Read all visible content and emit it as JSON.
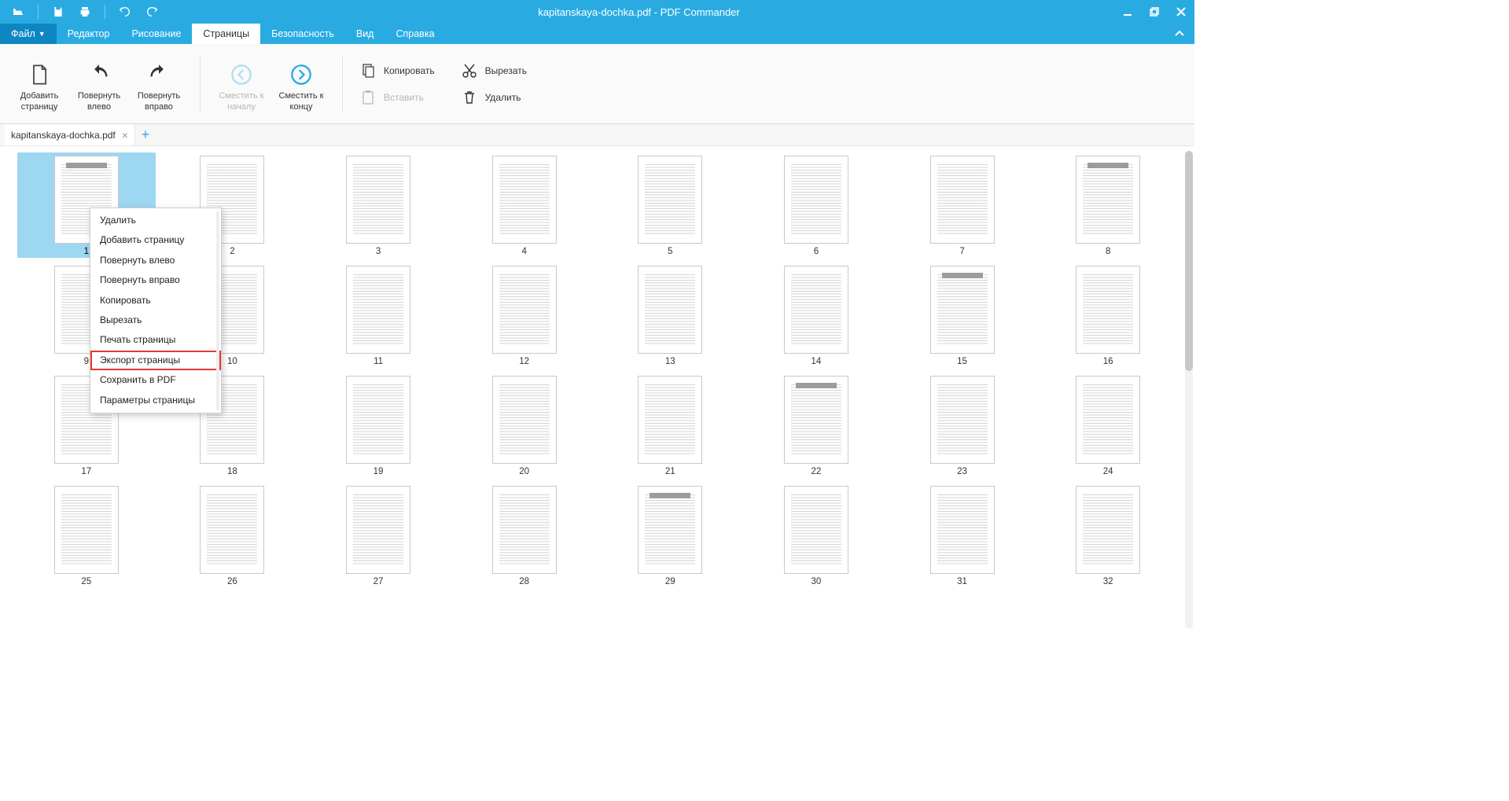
{
  "window": {
    "title": "kapitanskaya-dochka.pdf - PDF Commander"
  },
  "menubar": {
    "file": "Файл",
    "items": [
      "Редактор",
      "Рисование",
      "Страницы",
      "Безопасность",
      "Вид",
      "Справка"
    ],
    "active_index": 2
  },
  "ribbon": {
    "add_page": "Добавить\nстраницу",
    "rotate_left": "Повернуть\nвлево",
    "rotate_right": "Повернуть\nвправо",
    "shift_start": "Сместить к\nначалу",
    "shift_end": "Сместить к\nконцу",
    "copy": "Копировать",
    "paste": "Вставить",
    "cut": "Вырезать",
    "delete": "Удалить"
  },
  "doc_tab": {
    "name": "kapitanskaya-dochka.pdf"
  },
  "context_menu": {
    "items": [
      "Удалить",
      "Добавить страницу",
      "Повернуть влево",
      "Повернуть вправо",
      "Копировать",
      "Вырезать",
      "Печать страницы",
      "Экспорт страницы",
      "Сохранить в PDF",
      "Параметры страницы"
    ],
    "highlighted_index": 7
  },
  "pages": {
    "selected": 1,
    "visible": [
      1,
      2,
      3,
      4,
      5,
      6,
      7,
      8,
      9,
      10,
      11,
      12,
      13,
      14,
      15,
      16,
      17,
      18,
      19,
      20,
      21,
      22,
      23,
      24,
      25,
      26,
      27,
      28,
      29,
      30,
      31,
      32
    ]
  }
}
